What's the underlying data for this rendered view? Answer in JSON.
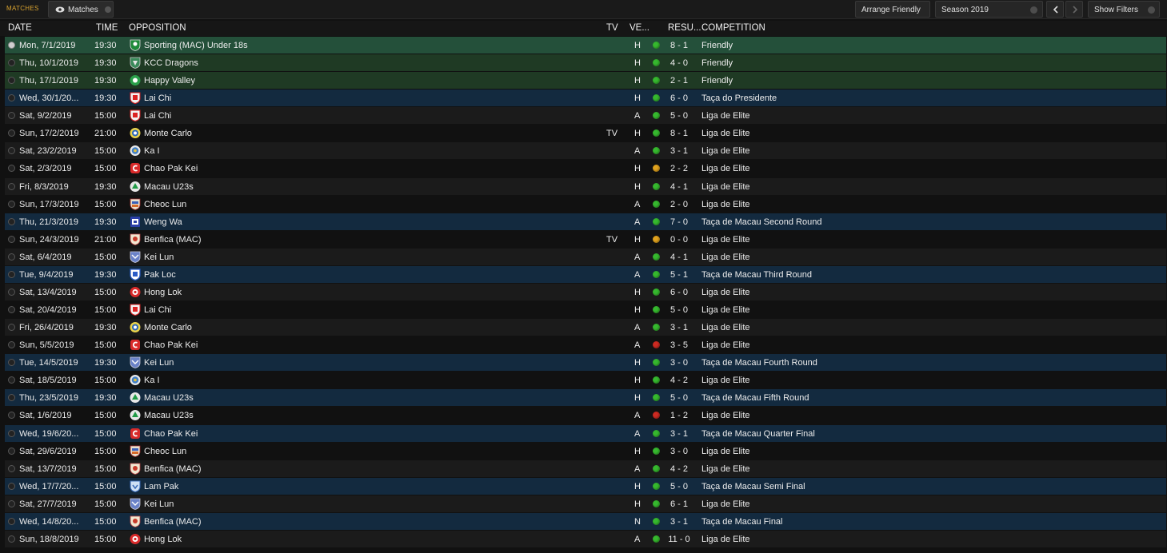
{
  "toolbar": {
    "section_label": "MATCHES",
    "tab_label": "Matches",
    "arrange_friendly": "Arrange Friendly",
    "season": "Season 2019",
    "show_filters": "Show Filters"
  },
  "columns": {
    "date": "DATE",
    "time": "TIME",
    "opposition": "OPPOSITION",
    "tv": "TV",
    "venue": "VE...",
    "result": "RESU...",
    "competition": "COMPETITION"
  },
  "colors": {
    "win": "#36b82e",
    "draw": "#e0a21e",
    "loss": "#cc2a22",
    "friendly_row": "#1f3a24",
    "cup_row": "#132a3f"
  },
  "matches": [
    {
      "date": "Mon, 7/1/2019",
      "time": "19:30",
      "opposition": "Sporting (MAC) Under 18s",
      "tv": "",
      "venue": "H",
      "result": "8 - 1",
      "outcome": "win",
      "competition": "Friendly",
      "kind": "friendly",
      "crest": "green-lion-crest"
    },
    {
      "date": "Thu, 10/1/2019",
      "time": "19:30",
      "opposition": "KCC Dragons",
      "tv": "",
      "venue": "H",
      "result": "4 - 0",
      "outcome": "win",
      "competition": "Friendly",
      "kind": "friendly",
      "crest": "dragon-crest"
    },
    {
      "date": "Thu, 17/1/2019",
      "time": "19:30",
      "opposition": "Happy Valley",
      "tv": "",
      "venue": "H",
      "result": "2 - 1",
      "outcome": "win",
      "competition": "Friendly",
      "kind": "friendly",
      "crest": "green-ball-crest"
    },
    {
      "date": "Wed, 30/1/20...",
      "time": "19:30",
      "opposition": "Lai Chi",
      "tv": "",
      "venue": "H",
      "result": "6 - 0",
      "outcome": "win",
      "competition": "Taça do Presidente",
      "kind": "cup",
      "crest": "red-shield-crest"
    },
    {
      "date": "Sat, 9/2/2019",
      "time": "15:00",
      "opposition": "Lai Chi",
      "tv": "",
      "venue": "A",
      "result": "5 - 0",
      "outcome": "win",
      "competition": "Liga de Elite",
      "kind": "league",
      "crest": "red-shield-crest"
    },
    {
      "date": "Sun, 17/2/2019",
      "time": "21:00",
      "opposition": "Monte Carlo",
      "tv": "TV",
      "venue": "H",
      "result": "8 - 1",
      "outcome": "win",
      "competition": "Liga de Elite",
      "kind": "league",
      "crest": "yellow-circle-crest"
    },
    {
      "date": "Sat, 23/2/2019",
      "time": "15:00",
      "opposition": "Ka I",
      "tv": "",
      "venue": "A",
      "result": "3 - 1",
      "outcome": "win",
      "competition": "Liga de Elite",
      "kind": "league",
      "crest": "blue-circle-crest"
    },
    {
      "date": "Sat, 2/3/2019",
      "time": "15:00",
      "opposition": "Chao Pak Kei",
      "tv": "",
      "venue": "H",
      "result": "2 - 2",
      "outcome": "draw",
      "competition": "Liga de Elite",
      "kind": "league",
      "crest": "red-c-crest"
    },
    {
      "date": "Fri, 8/3/2019",
      "time": "19:30",
      "opposition": "Macau U23s",
      "tv": "",
      "venue": "H",
      "result": "4 - 1",
      "outcome": "win",
      "competition": "Liga de Elite",
      "kind": "league",
      "crest": "green-circle-crest"
    },
    {
      "date": "Sun, 17/3/2019",
      "time": "15:00",
      "opposition": "Cheoc Lun",
      "tv": "",
      "venue": "A",
      "result": "2 - 0",
      "outcome": "win",
      "competition": "Liga de Elite",
      "kind": "league",
      "crest": "orange-shield-crest"
    },
    {
      "date": "Thu, 21/3/2019",
      "time": "19:30",
      "opposition": "Weng Wa",
      "tv": "",
      "venue": "A",
      "result": "7 - 0",
      "outcome": "win",
      "competition": "Taça de Macau Second Round",
      "kind": "cup",
      "crest": "blue-square-crest"
    },
    {
      "date": "Sun, 24/3/2019",
      "time": "21:00",
      "opposition": "Benfica (MAC)",
      "tv": "TV",
      "venue": "H",
      "result": "0 - 0",
      "outcome": "draw",
      "competition": "Liga de Elite",
      "kind": "league",
      "crest": "eagle-crest"
    },
    {
      "date": "Sat, 6/4/2019",
      "time": "15:00",
      "opposition": "Kei Lun",
      "tv": "",
      "venue": "A",
      "result": "4 - 1",
      "outcome": "win",
      "competition": "Liga de Elite",
      "kind": "league",
      "crest": "blue-wing-crest"
    },
    {
      "date": "Tue, 9/4/2019",
      "time": "19:30",
      "opposition": "Pak Loc",
      "tv": "",
      "venue": "A",
      "result": "5 - 1",
      "outcome": "win",
      "competition": "Taça de Macau Third Round",
      "kind": "cup",
      "crest": "blue-badge-crest"
    },
    {
      "date": "Sat, 13/4/2019",
      "time": "15:00",
      "opposition": "Hong Lok",
      "tv": "",
      "venue": "H",
      "result": "6 - 0",
      "outcome": "win",
      "competition": "Liga de Elite",
      "kind": "league",
      "crest": "red-ring-crest"
    },
    {
      "date": "Sat, 20/4/2019",
      "time": "15:00",
      "opposition": "Lai Chi",
      "tv": "",
      "venue": "H",
      "result": "5 - 0",
      "outcome": "win",
      "competition": "Liga de Elite",
      "kind": "league",
      "crest": "red-shield-crest"
    },
    {
      "date": "Fri, 26/4/2019",
      "time": "19:30",
      "opposition": "Monte Carlo",
      "tv": "",
      "venue": "A",
      "result": "3 - 1",
      "outcome": "win",
      "competition": "Liga de Elite",
      "kind": "league",
      "crest": "yellow-circle-crest"
    },
    {
      "date": "Sun, 5/5/2019",
      "time": "15:00",
      "opposition": "Chao Pak Kei",
      "tv": "",
      "venue": "A",
      "result": "3 - 5",
      "outcome": "loss",
      "competition": "Liga de Elite",
      "kind": "league",
      "crest": "red-c-crest"
    },
    {
      "date": "Tue, 14/5/2019",
      "time": "19:30",
      "opposition": "Kei Lun",
      "tv": "",
      "venue": "H",
      "result": "3 - 0",
      "outcome": "win",
      "competition": "Taça de Macau Fourth Round",
      "kind": "cup",
      "crest": "blue-wing-crest"
    },
    {
      "date": "Sat, 18/5/2019",
      "time": "15:00",
      "opposition": "Ka I",
      "tv": "",
      "venue": "H",
      "result": "4 - 2",
      "outcome": "win",
      "competition": "Liga de Elite",
      "kind": "league",
      "crest": "blue-circle-crest"
    },
    {
      "date": "Thu, 23/5/2019",
      "time": "19:30",
      "opposition": "Macau U23s",
      "tv": "",
      "venue": "H",
      "result": "5 - 0",
      "outcome": "win",
      "competition": "Taça de Macau Fifth Round",
      "kind": "cup",
      "crest": "green-circle-crest"
    },
    {
      "date": "Sat, 1/6/2019",
      "time": "15:00",
      "opposition": "Macau U23s",
      "tv": "",
      "venue": "A",
      "result": "1 - 2",
      "outcome": "loss",
      "competition": "Liga de Elite",
      "kind": "league",
      "crest": "green-circle-crest"
    },
    {
      "date": "Wed, 19/6/20...",
      "time": "15:00",
      "opposition": "Chao Pak Kei",
      "tv": "",
      "venue": "A",
      "result": "3 - 1",
      "outcome": "win",
      "competition": "Taça de Macau Quarter Final",
      "kind": "cup",
      "crest": "red-c-crest"
    },
    {
      "date": "Sat, 29/6/2019",
      "time": "15:00",
      "opposition": "Cheoc Lun",
      "tv": "",
      "venue": "H",
      "result": "3 - 0",
      "outcome": "win",
      "competition": "Liga de Elite",
      "kind": "league",
      "crest": "orange-shield-crest"
    },
    {
      "date": "Sat, 13/7/2019",
      "time": "15:00",
      "opposition": "Benfica (MAC)",
      "tv": "",
      "venue": "A",
      "result": "4 - 2",
      "outcome": "win",
      "competition": "Liga de Elite",
      "kind": "league",
      "crest": "eagle-crest"
    },
    {
      "date": "Wed, 17/7/20...",
      "time": "15:00",
      "opposition": "Lam Pak",
      "tv": "",
      "venue": "H",
      "result": "5 - 0",
      "outcome": "win",
      "competition": "Taça de Macau Semi Final",
      "kind": "cup",
      "crest": "blue-shield-crest"
    },
    {
      "date": "Sat, 27/7/2019",
      "time": "15:00",
      "opposition": "Kei Lun",
      "tv": "",
      "venue": "H",
      "result": "6 - 1",
      "outcome": "win",
      "competition": "Liga de Elite",
      "kind": "league",
      "crest": "blue-wing-crest"
    },
    {
      "date": "Wed, 14/8/20...",
      "time": "15:00",
      "opposition": "Benfica (MAC)",
      "tv": "",
      "venue": "N",
      "result": "3 - 1",
      "outcome": "win",
      "competition": "Taça de Macau Final",
      "kind": "cup",
      "crest": "eagle-crest"
    },
    {
      "date": "Sun, 18/8/2019",
      "time": "15:00",
      "opposition": "Hong Lok",
      "tv": "",
      "venue": "A",
      "result": "11 - 0",
      "outcome": "win",
      "competition": "Liga de Elite",
      "kind": "league",
      "crest": "red-ring-crest"
    }
  ]
}
